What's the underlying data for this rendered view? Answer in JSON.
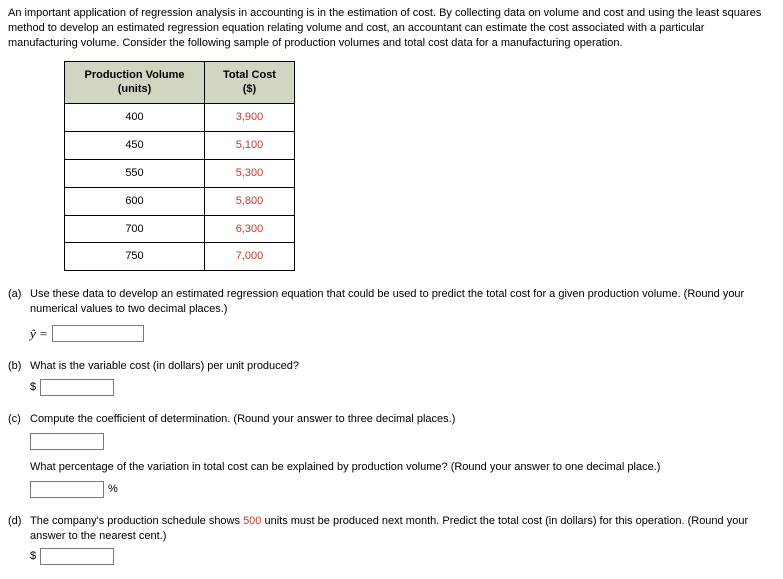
{
  "intro": "An important application of regression analysis in accounting is in the estimation of cost. By collecting data on volume and cost and using the least squares method to develop an estimated regression equation relating volume and cost, an accountant can estimate the cost associated with a particular manufacturing volume. Consider the following sample of production volumes and total cost data for a manufacturing operation.",
  "table": {
    "header_vol_line1": "Production Volume",
    "header_vol_line2": "(units)",
    "header_cost_line1": "Total Cost",
    "header_cost_line2": "($)",
    "rows": [
      {
        "vol": "400",
        "cost": "3,900"
      },
      {
        "vol": "450",
        "cost": "5,100"
      },
      {
        "vol": "550",
        "cost": "5,300"
      },
      {
        "vol": "600",
        "cost": "5,800"
      },
      {
        "vol": "700",
        "cost": "6,300"
      },
      {
        "vol": "750",
        "cost": "7,000"
      }
    ]
  },
  "parts": {
    "a": {
      "label": "(a)",
      "text": "Use these data to develop an estimated regression equation that could be used to predict the total cost for a given production volume. (Round your numerical values to two decimal places.)",
      "yhat": "ŷ ="
    },
    "b": {
      "label": "(b)",
      "text": "What is the variable cost (in dollars) per unit produced?",
      "prefix": "$"
    },
    "c": {
      "label": "(c)",
      "text1": "Compute the coefficient of determination. (Round your answer to three decimal places.)",
      "text2": "What percentage of the variation in total cost can be explained by production volume? (Round your answer to one decimal place.)",
      "suffix": "%"
    },
    "d": {
      "label": "(d)",
      "text_pre": "The company's production schedule shows ",
      "highlight": "500",
      "text_post": " units must be produced next month. Predict the total cost (in dollars) for this operation. (Round your answer to the nearest cent.)",
      "prefix": "$"
    }
  }
}
